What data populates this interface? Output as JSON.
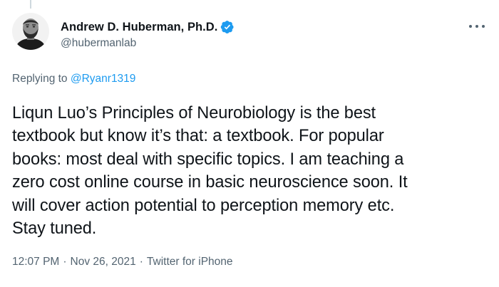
{
  "author": {
    "display_name": "Andrew D. Huberman, Ph.D.",
    "handle": "@hubermanlab",
    "verified": true,
    "avatar_icon": "profile-photo-icon"
  },
  "reply": {
    "prefix": "Replying to",
    "mention": "@Ryanr1319"
  },
  "tweet": {
    "lines": [
      "Liqun Luo’s Principles of Neurobiology is the best",
      "textbook but know it’s that: a textbook. For popular",
      "books: most deal with specific topics. I am teaching a",
      "zero cost online course in basic neuroscience soon. It",
      "will cover action potential to perception memory etc.",
      "Stay tuned."
    ]
  },
  "meta": {
    "time": "12:07 PM",
    "date": "Nov 26, 2021",
    "separator": "·",
    "source": "Twitter for iPhone"
  },
  "icons": {
    "verified": "verified-badge-icon",
    "more": "more-options-icon"
  },
  "colors": {
    "text_primary": "#0f1419",
    "text_secondary": "#536471",
    "accent_blue": "#1d9bf0",
    "background": "#ffffff"
  }
}
